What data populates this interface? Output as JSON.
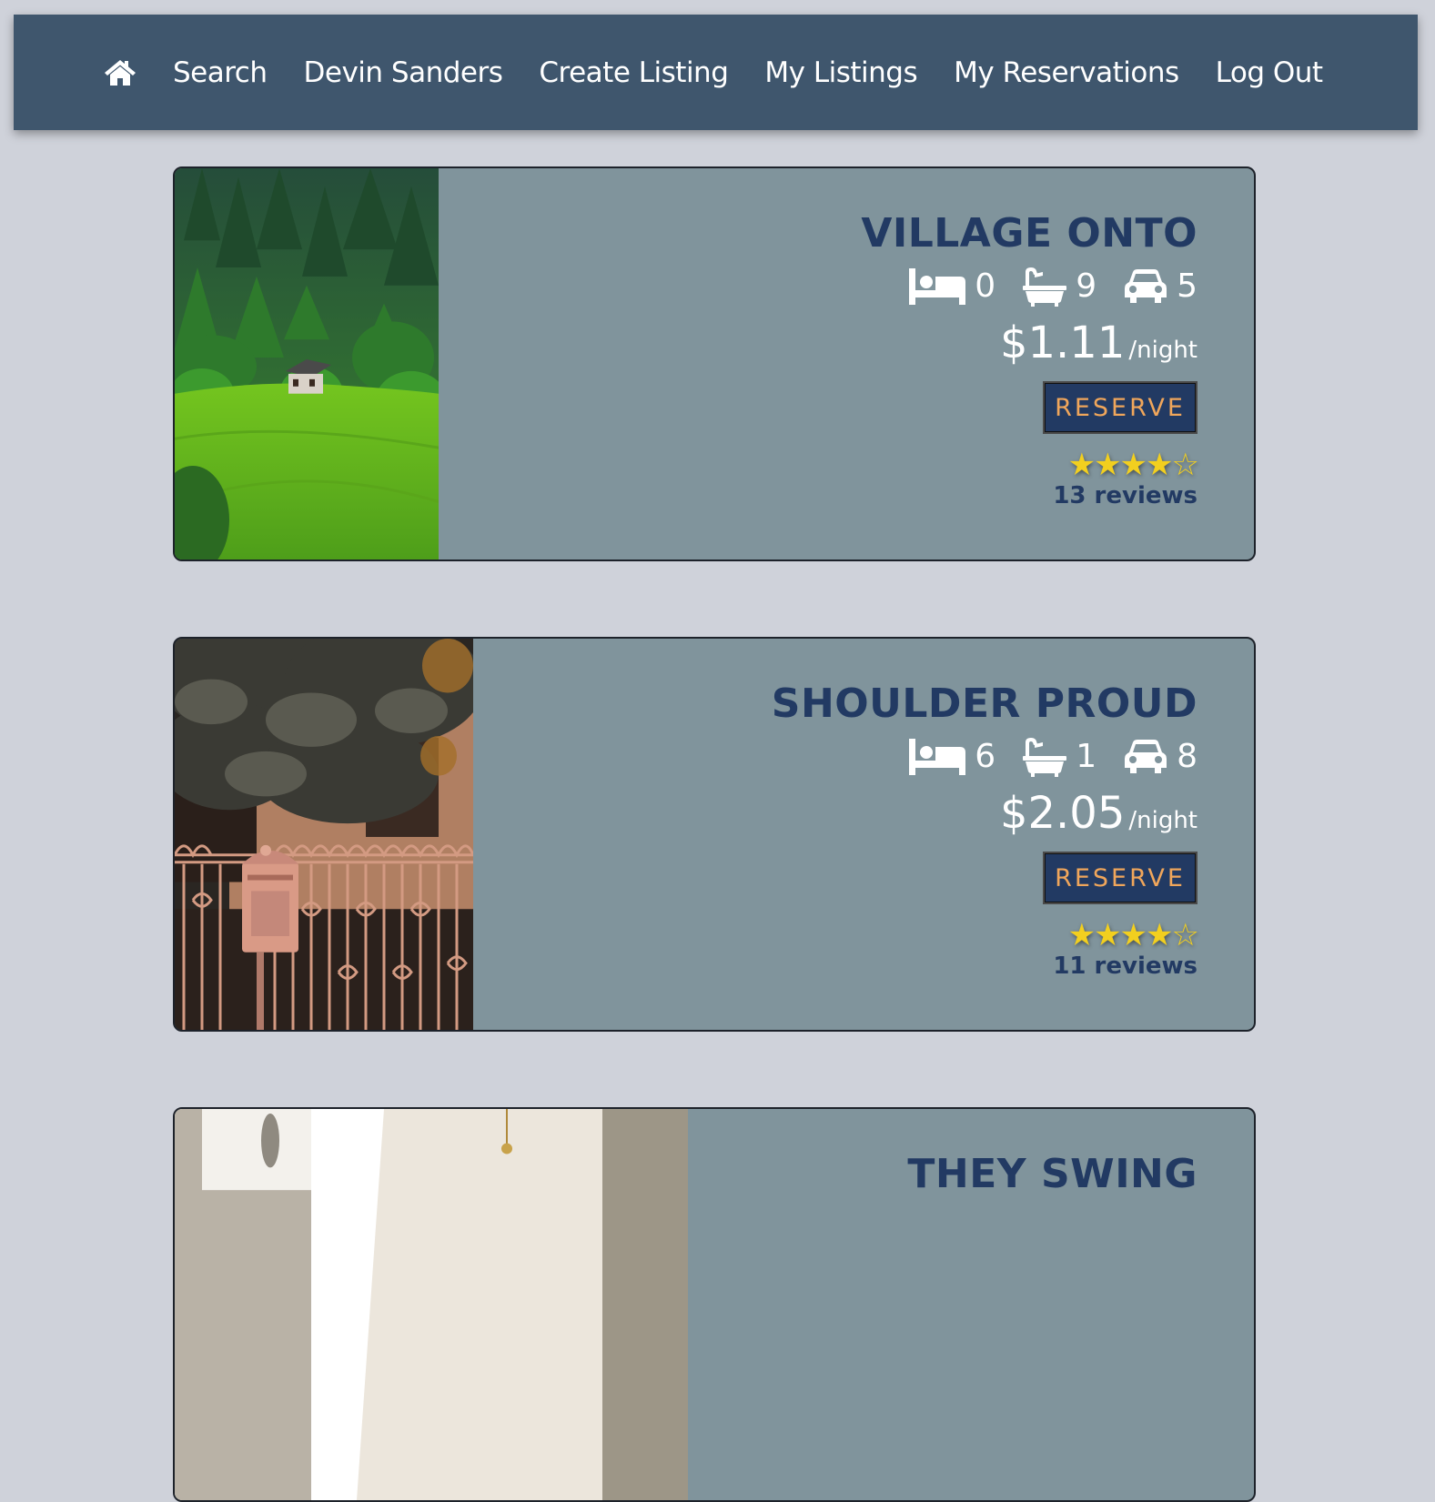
{
  "nav": {
    "home_icon": "home-icon",
    "links": {
      "search": "Search",
      "user": "Devin Sanders",
      "create": "Create Listing",
      "my_listings": "My Listings",
      "my_reservations": "My Reservations",
      "logout": "Log Out"
    }
  },
  "colors": {
    "navbar": "#3f566d",
    "page_bg": "#cfd2da",
    "card_bg": "#80949c",
    "title": "#223a63",
    "button_text": "#f0a65b",
    "star": "#f2cf1f"
  },
  "listings": [
    {
      "title": "VILLAGE ONTO",
      "photo": "green hillside with small wooden cabin and pine forest",
      "beds": "0",
      "baths": "9",
      "parking": "5",
      "price": "$1.11",
      "per_night": "/night",
      "reserve_label": "RESERVE",
      "rating": 4,
      "stars": "★★★★☆",
      "reviews": "13 reviews"
    },
    {
      "title": "SHOULDER PROUD",
      "photo": "ornate iron fence with mailbox in front of house under tree",
      "beds": "6",
      "baths": "1",
      "parking": "8",
      "price": "$2.05",
      "per_night": "/night",
      "reserve_label": "RESERVE",
      "rating": 4,
      "stars": "★★★★☆",
      "reviews": "11 reviews"
    },
    {
      "title": "THEY SWING",
      "photo": "bright interior with arched window"
    }
  ]
}
